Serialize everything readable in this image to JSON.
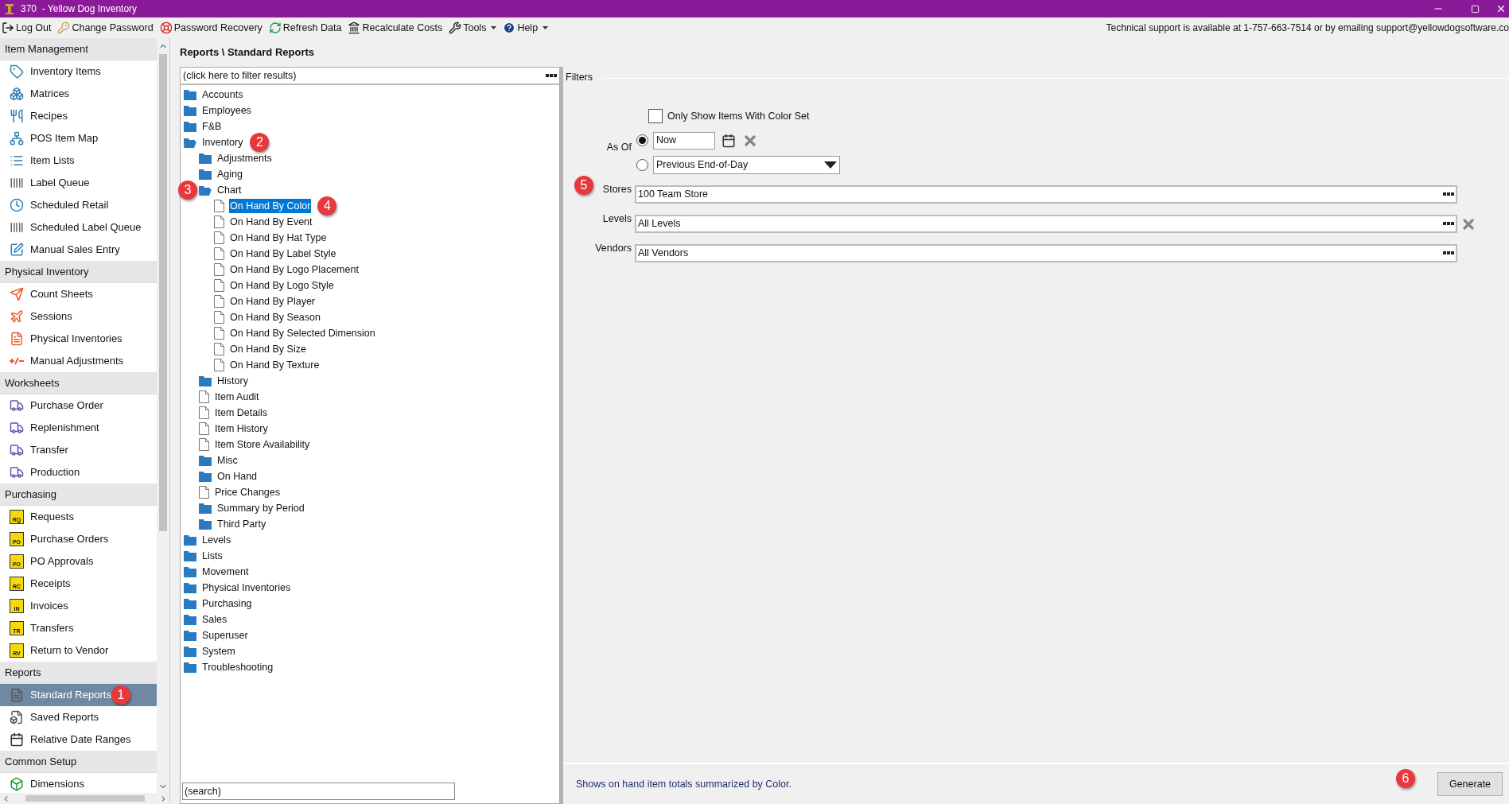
{
  "window": {
    "title": "370  - Yellow Dog Inventory"
  },
  "toolbar": {
    "items": [
      {
        "label": "Log Out",
        "kind": "button"
      },
      {
        "label": "Change Password",
        "kind": "button"
      },
      {
        "label": "Password Recovery",
        "kind": "button"
      },
      {
        "label": "Refresh Data",
        "kind": "button"
      },
      {
        "label": "Recalculate Costs",
        "kind": "button"
      },
      {
        "label": "Tools",
        "kind": "menu"
      },
      {
        "label": "Help",
        "kind": "menu"
      }
    ],
    "support_text": "Technical support is available at 1-757-663-7514 or by emailing support@yellowdogsoftware.co"
  },
  "sidebar": {
    "sections": [
      {
        "title": "Item Management",
        "items": [
          {
            "label": "Inventory Items",
            "selected": false
          },
          {
            "label": "Matrices",
            "selected": false
          },
          {
            "label": "Recipes",
            "selected": false
          },
          {
            "label": "POS Item Map",
            "selected": false
          },
          {
            "label": "Item Lists",
            "selected": false
          },
          {
            "label": "Label Queue",
            "selected": false
          },
          {
            "label": "Scheduled Retail",
            "selected": false
          },
          {
            "label": "Scheduled Label Queue",
            "selected": false
          },
          {
            "label": "Manual Sales Entry",
            "selected": false
          }
        ]
      },
      {
        "title": "Physical Inventory",
        "items": [
          {
            "label": "Count Sheets",
            "selected": false
          },
          {
            "label": "Sessions",
            "selected": false
          },
          {
            "label": "Physical Inventories",
            "selected": false
          },
          {
            "label": "Manual Adjustments",
            "selected": false
          }
        ]
      },
      {
        "title": "Worksheets",
        "items": [
          {
            "label": "Purchase Order",
            "selected": false
          },
          {
            "label": "Replenishment",
            "selected": false
          },
          {
            "label": "Transfer",
            "selected": false
          },
          {
            "label": "Production",
            "selected": false
          }
        ]
      },
      {
        "title": "Purchasing",
        "items": [
          {
            "label": "Requests",
            "selected": false,
            "badge": "RQ"
          },
          {
            "label": "Purchase Orders",
            "selected": false,
            "badge": "PO"
          },
          {
            "label": "PO Approvals",
            "selected": false,
            "badge": "PO"
          },
          {
            "label": "Receipts",
            "selected": false,
            "badge": "RC"
          },
          {
            "label": "Invoices",
            "selected": false,
            "badge": "IN"
          },
          {
            "label": "Transfers",
            "selected": false,
            "badge": "TR"
          },
          {
            "label": "Return to Vendor",
            "selected": false,
            "badge": "RV"
          }
        ]
      },
      {
        "title": "Reports",
        "items": [
          {
            "label": "Standard Reports",
            "selected": true,
            "callout": "1"
          },
          {
            "label": "Saved Reports",
            "selected": false
          },
          {
            "label": "Relative Date Ranges",
            "selected": false
          }
        ]
      },
      {
        "title": "Common Setup",
        "items": [
          {
            "label": "Dimensions",
            "selected": false
          }
        ]
      }
    ]
  },
  "breadcrumb": "Reports \\ Standard Reports",
  "tree": {
    "filter_placeholder": "(click here to filter results)",
    "search_placeholder": "(search)",
    "nodes": [
      {
        "label": "Accounts",
        "kind": "folder",
        "expanded": false,
        "selected": false
      },
      {
        "label": "Employees",
        "kind": "folder",
        "expanded": false,
        "selected": false
      },
      {
        "label": "F&B",
        "kind": "folder",
        "expanded": false,
        "selected": false
      },
      {
        "label": "Inventory",
        "kind": "folder",
        "expanded": true,
        "selected": false,
        "callout": "2",
        "children": [
          {
            "label": "Adjustments",
            "kind": "folder",
            "expanded": false,
            "selected": false
          },
          {
            "label": "Aging",
            "kind": "folder",
            "expanded": false,
            "selected": false
          },
          {
            "label": "Chart",
            "kind": "folder",
            "expanded": true,
            "selected": false,
            "callout": "3",
            "children": [
              {
                "label": "On Hand By Color",
                "kind": "report",
                "selected": true,
                "callout": "4"
              },
              {
                "label": "On Hand By Event",
                "kind": "report",
                "selected": false
              },
              {
                "label": "On Hand By Hat Type",
                "kind": "report",
                "selected": false
              },
              {
                "label": "On Hand By Label Style",
                "kind": "report",
                "selected": false
              },
              {
                "label": "On Hand By Logo Placement",
                "kind": "report",
                "selected": false
              },
              {
                "label": "On Hand By Logo Style",
                "kind": "report",
                "selected": false
              },
              {
                "label": "On Hand By Player",
                "kind": "report",
                "selected": false
              },
              {
                "label": "On Hand By Season",
                "kind": "report",
                "selected": false
              },
              {
                "label": "On Hand By Selected Dimension",
                "kind": "report",
                "selected": false
              },
              {
                "label": "On Hand By Size",
                "kind": "report",
                "selected": false
              },
              {
                "label": "On Hand By Texture",
                "kind": "report",
                "selected": false
              }
            ]
          },
          {
            "label": "History",
            "kind": "folder",
            "expanded": false,
            "selected": false
          },
          {
            "label": "Item Audit",
            "kind": "report",
            "selected": false
          },
          {
            "label": "Item Details",
            "kind": "report",
            "selected": false
          },
          {
            "label": "Item History",
            "kind": "report",
            "selected": false
          },
          {
            "label": "Item Store Availability",
            "kind": "report",
            "selected": false
          },
          {
            "label": "Misc",
            "kind": "folder",
            "expanded": false,
            "selected": false
          },
          {
            "label": "On Hand",
            "kind": "folder",
            "expanded": false,
            "selected": false
          },
          {
            "label": "Price Changes",
            "kind": "report",
            "selected": false
          },
          {
            "label": "Summary by Period",
            "kind": "folder",
            "expanded": false,
            "selected": false
          },
          {
            "label": "Third Party",
            "kind": "folder",
            "expanded": false,
            "selected": false
          }
        ]
      },
      {
        "label": "Levels",
        "kind": "folder",
        "expanded": false,
        "selected": false
      },
      {
        "label": "Lists",
        "kind": "folder",
        "expanded": false,
        "selected": false
      },
      {
        "label": "Movement",
        "kind": "folder",
        "expanded": false,
        "selected": false
      },
      {
        "label": "Physical Inventories",
        "kind": "folder",
        "expanded": false,
        "selected": false
      },
      {
        "label": "Purchasing",
        "kind": "folder",
        "expanded": false,
        "selected": false
      },
      {
        "label": "Sales",
        "kind": "folder",
        "expanded": false,
        "selected": false
      },
      {
        "label": "Superuser",
        "kind": "folder",
        "expanded": false,
        "selected": false
      },
      {
        "label": "System",
        "kind": "folder",
        "expanded": false,
        "selected": false
      },
      {
        "label": "Troubleshooting",
        "kind": "folder",
        "expanded": false,
        "selected": false
      }
    ]
  },
  "filters": {
    "title": "Filters",
    "checkbox": {
      "label": "Only Show Items With Color Set",
      "checked": false
    },
    "as_of": {
      "label": "As Of",
      "options": [
        {
          "kind": "date",
          "value": "Now",
          "selected": true
        },
        {
          "kind": "dropdown",
          "value": "Previous End-of-Day",
          "selected": false
        }
      ]
    },
    "fields": [
      {
        "label": "Stores",
        "value": "100 Team Store",
        "clearable": false,
        "callout": "5"
      },
      {
        "label": "Levels",
        "value": "All Levels",
        "clearable": true
      },
      {
        "label": "Vendors",
        "value": "All Vendors",
        "clearable": false
      }
    ]
  },
  "description": "Shows on hand item totals summarized by Color.",
  "generate": {
    "label": "Generate",
    "callout": "6"
  }
}
